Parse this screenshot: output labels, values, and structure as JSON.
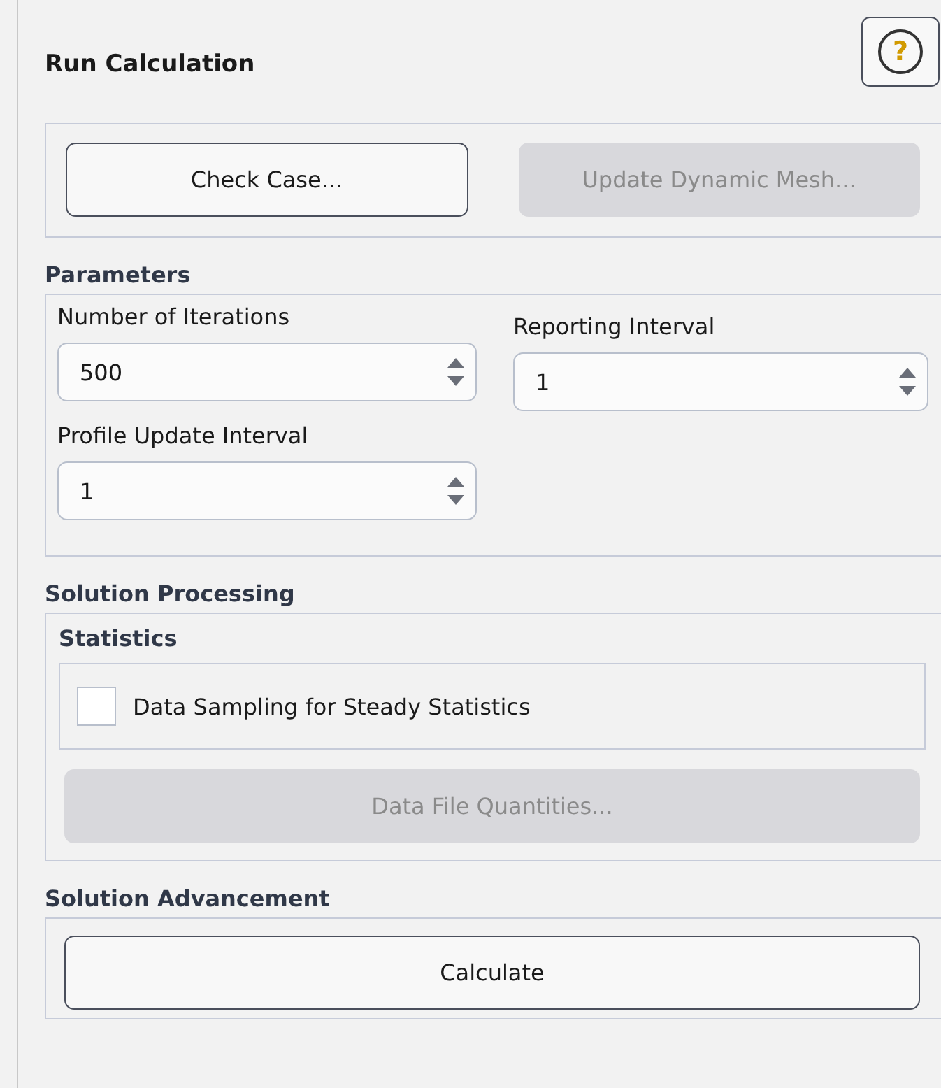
{
  "panel": {
    "title": "Run Calculation",
    "help_icon": "?"
  },
  "actions": [
    {
      "label": "Check Case...",
      "disabled": false
    },
    {
      "label": "Update Dynamic Mesh...",
      "disabled": true
    }
  ],
  "parameters": {
    "heading": "Parameters",
    "fields": [
      {
        "label": "Number of Iterations",
        "value": "500"
      },
      {
        "label": "Reporting Interval",
        "value": "1"
      },
      {
        "label": "Profile Update Interval",
        "value": "1"
      }
    ]
  },
  "solution_processing": {
    "heading": "Solution Processing",
    "statistics": {
      "heading": "Statistics",
      "checkbox": {
        "label": "Data Sampling for Steady Statistics",
        "checked": false
      },
      "button": {
        "label": "Data File Quantities...",
        "disabled": true
      }
    }
  },
  "solution_advancement": {
    "heading": "Solution Advancement",
    "button": {
      "label": "Calculate",
      "disabled": false
    }
  }
}
